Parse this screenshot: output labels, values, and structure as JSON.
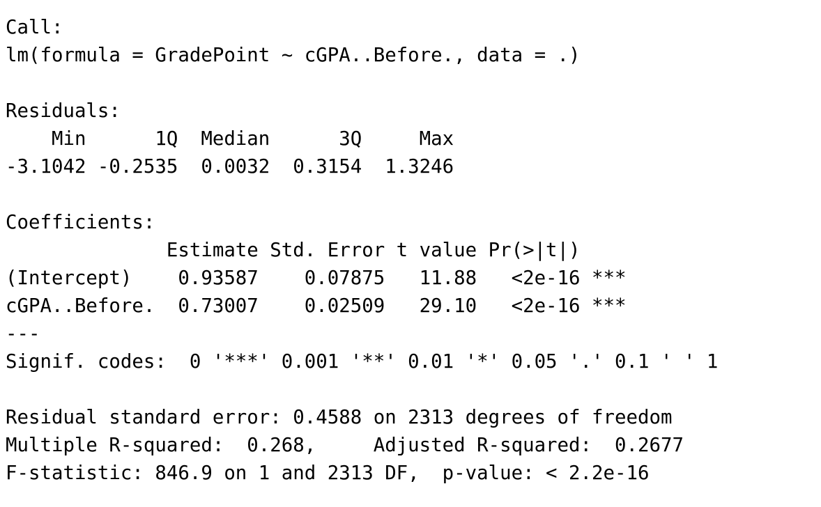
{
  "lines": [
    "Call:",
    "lm(formula = GradePoint ~ cGPA..Before., data = .)",
    "",
    "Residuals:",
    "    Min      1Q  Median      3Q     Max ",
    "-3.1042 -0.2535  0.0032  0.3154  1.3246 ",
    "",
    "Coefficients:",
    "              Estimate Std. Error t value Pr(>|t|)    ",
    "(Intercept)    0.93587    0.07875   11.88   <2e-16 ***",
    "cGPA..Before.  0.73007    0.02509   29.10   <2e-16 ***",
    "---",
    "Signif. codes:  0 '***' 0.001 '**' 0.01 '*' 0.05 '.' 0.1 ' ' 1",
    "",
    "Residual standard error: 0.4588 on 2313 degrees of freedom",
    "Multiple R-squared:  0.268,\tAdjusted R-squared:  0.2677 ",
    "F-statistic: 846.9 on 1 and 2313 DF,  p-value: < 2.2e-16"
  ]
}
